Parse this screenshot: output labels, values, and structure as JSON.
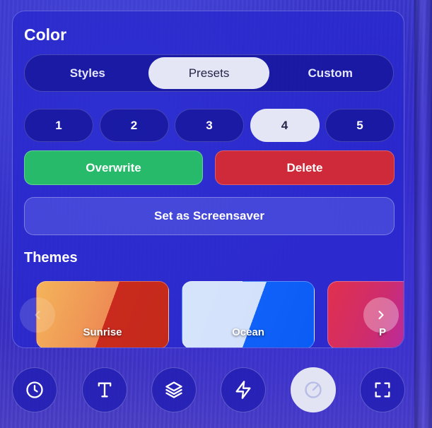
{
  "panel": {
    "title": "Color",
    "tabs": [
      {
        "label": "Styles",
        "active": false
      },
      {
        "label": "Presets",
        "active": true
      },
      {
        "label": "Custom",
        "active": false
      }
    ],
    "presets": [
      {
        "label": "1",
        "active": false
      },
      {
        "label": "2",
        "active": false
      },
      {
        "label": "3",
        "active": false
      },
      {
        "label": "4",
        "active": true
      },
      {
        "label": "5",
        "active": false
      }
    ],
    "overwrite_label": "Overwrite",
    "delete_label": "Delete",
    "screensaver_label": "Set as Screensaver",
    "themes_title": "Themes",
    "themes": [
      {
        "label": "Sunrise"
      },
      {
        "label": "Ocean"
      },
      {
        "label": "P"
      }
    ]
  },
  "dock": {
    "items": [
      {
        "icon": "clock-icon",
        "active": false
      },
      {
        "icon": "text-icon",
        "active": false
      },
      {
        "icon": "layers-icon",
        "active": false
      },
      {
        "icon": "lightning-icon",
        "active": false
      },
      {
        "icon": "palette-icon",
        "active": true
      },
      {
        "icon": "fullscreen-icon",
        "active": false
      }
    ]
  },
  "colors": {
    "overwrite": "#27ba6a",
    "delete": "#cf2a3a",
    "active_pill": "#e4e6f5",
    "panel": "#2828cd"
  }
}
